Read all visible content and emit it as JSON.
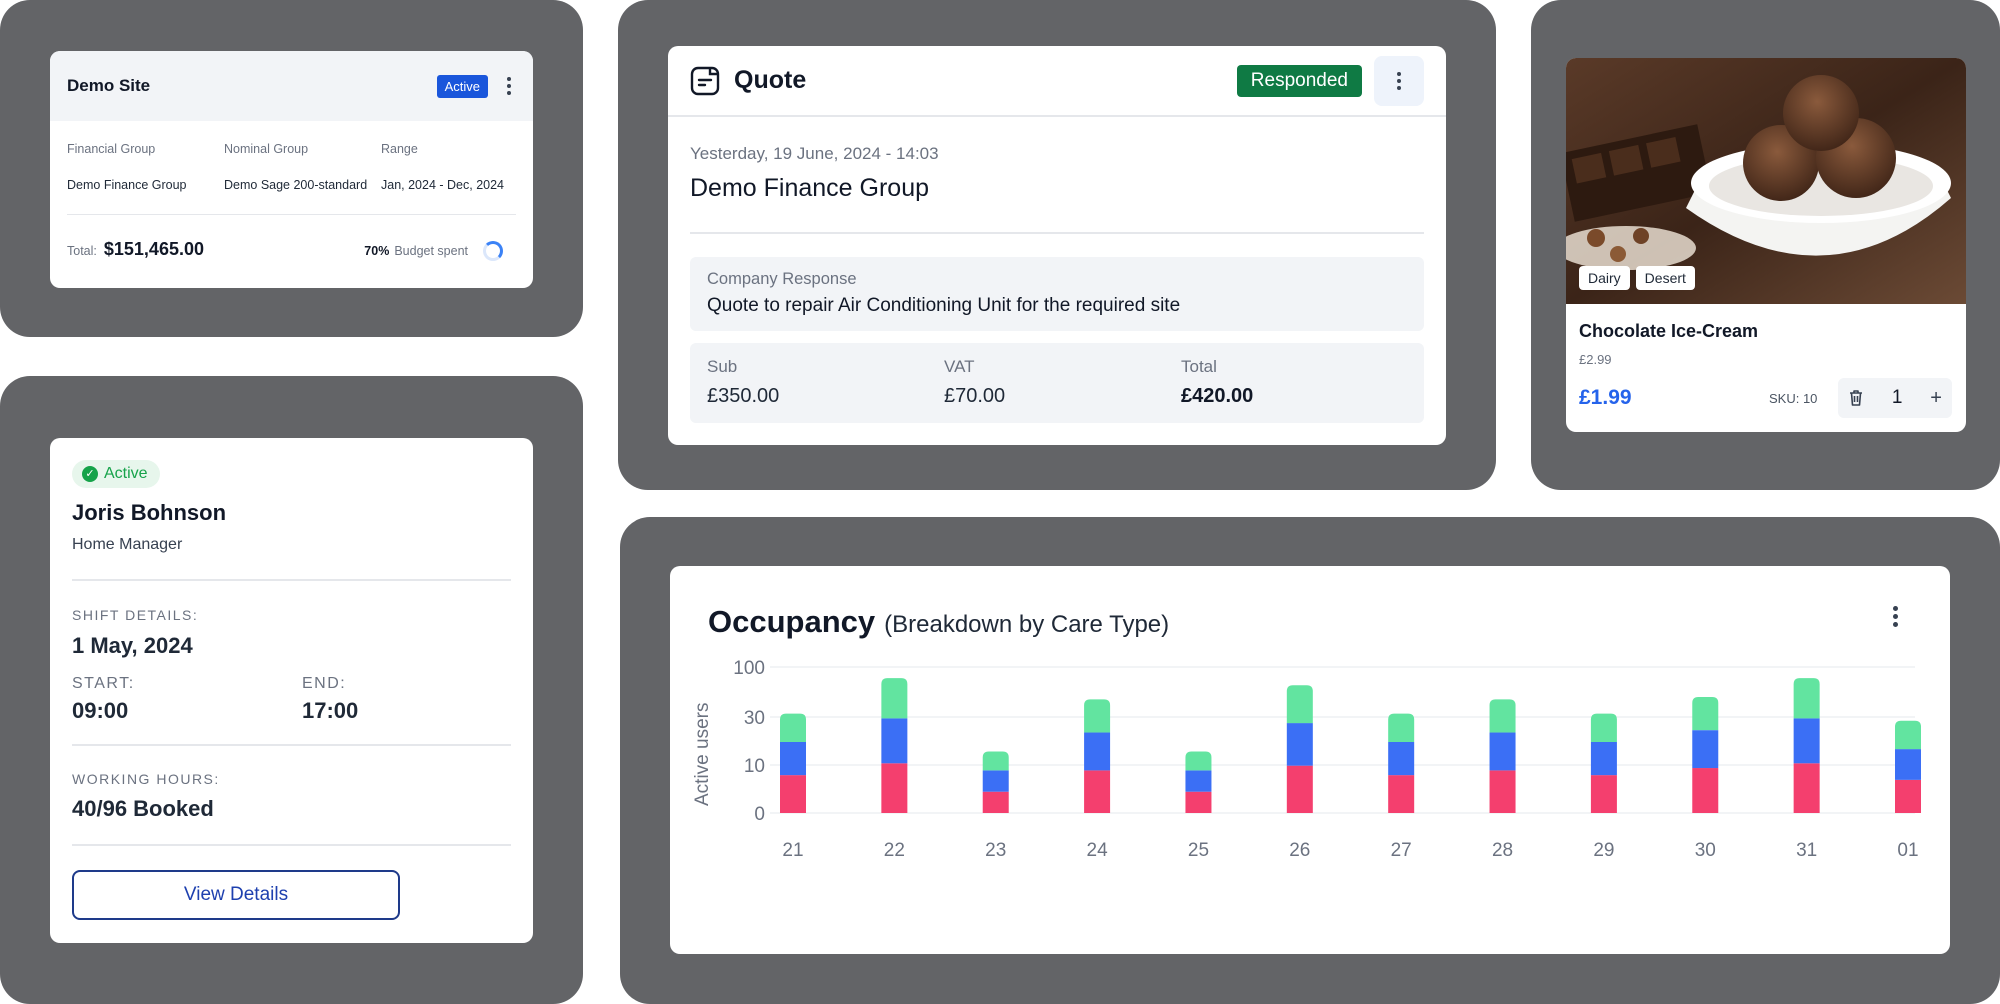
{
  "site_card": {
    "title": "Demo Site",
    "status": "Active",
    "labels": {
      "financial_group": "Financial Group",
      "nominal_group": "Nominal Group",
      "range": "Range"
    },
    "values": {
      "financial_group": "Demo Finance Group",
      "nominal_group": "Demo Sage 200-standard",
      "range": "Jan, 2024 - Dec, 2024"
    },
    "total_label": "Total:",
    "total_value": "$151,465.00",
    "budget_percent": "70%",
    "budget_label": "Budget spent",
    "budget_fraction": 0.7
  },
  "shift_card": {
    "status": "Active",
    "name": "Joris Bohnson",
    "role": "Home Manager",
    "shift_details_label": "SHIFT DETAILS:",
    "shift_date": "1 May, 2024",
    "start_label": "START:",
    "start_time": "09:00",
    "end_label": "END:",
    "end_time": "17:00",
    "working_hours_label": "WORKING HOURS:",
    "working_hours": "40/96 Booked",
    "button_label": "View Details"
  },
  "quote_card": {
    "title": "Quote",
    "status": "Responded",
    "date": "Yesterday, 19 June, 2024 - 14:03",
    "company": "Demo Finance Group",
    "response_label": "Company Response",
    "response_text": "Quote to repair Air Conditioning Unit for the required site",
    "totals": [
      {
        "label": "Sub",
        "value": "£350.00"
      },
      {
        "label": "VAT",
        "value": "£70.00"
      },
      {
        "label": "Total",
        "value": "£420.00"
      }
    ]
  },
  "product_card": {
    "tags": [
      "Dairy",
      "Desert"
    ],
    "name": "Chocolate Ice-Cream",
    "old_price": "£2.99",
    "price": "£1.99",
    "sku": "SKU: 10",
    "quantity": "1",
    "plus": "+"
  },
  "chart_data": {
    "type": "bar",
    "stacked": true,
    "title": "Occupancy",
    "subtitle": "(Breakdown by Care Type)",
    "ylabel": "Active users",
    "yticks": [
      "0",
      "10",
      "30",
      "100"
    ],
    "categories": [
      "21",
      "22",
      "23",
      "24",
      "25",
      "26",
      "27",
      "28",
      "29",
      "30",
      "31",
      "01"
    ],
    "series": [
      {
        "values": [
          8,
          10.5,
          4.5,
          9,
          4.5,
          10,
          8,
          9,
          8,
          9.5,
          10.5,
          7
        ],
        "color": "#f43f6e"
      },
      {
        "values": [
          7,
          9.5,
          4.5,
          8,
          4.5,
          9,
          7,
          8,
          7,
          8,
          9.5,
          6.5
        ],
        "color": "#3b6ff5"
      },
      {
        "values": [
          6,
          8.5,
          4,
          7,
          4,
          8,
          6,
          7,
          6,
          7,
          8.5,
          6
        ],
        "color": "#62e4a0"
      }
    ],
    "ylim": [
      0,
      30
    ],
    "grid": true
  }
}
